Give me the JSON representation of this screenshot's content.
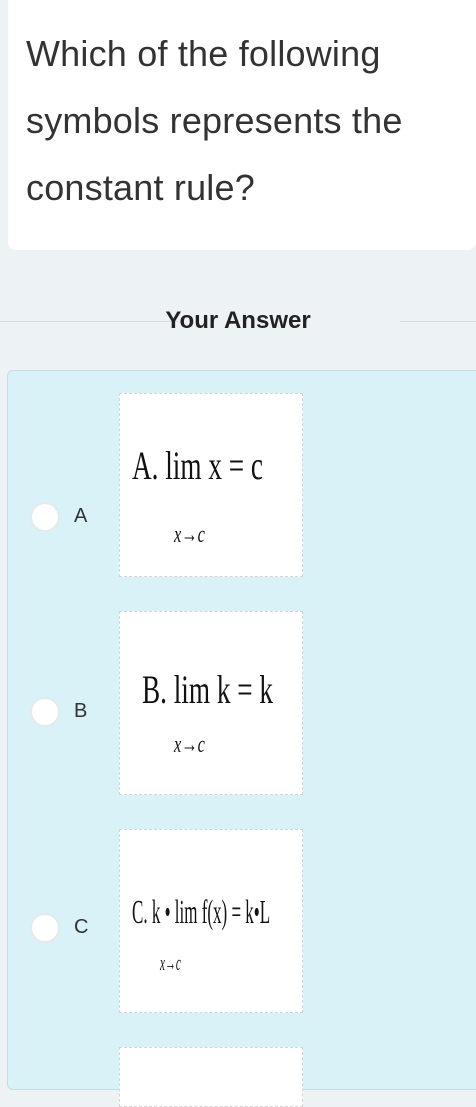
{
  "question": {
    "lines": [
      "Which of the following",
      "symbols represents the",
      "constant rule?"
    ]
  },
  "answer_section": {
    "heading": "Your Answer"
  },
  "options": [
    {
      "letter": "A",
      "formula": "A. lim x = c",
      "subscript": "x→c",
      "selected": false
    },
    {
      "letter": "B",
      "formula": "B. lim k = k",
      "subscript": "x→c",
      "selected": false
    },
    {
      "letter": "C",
      "formula": "C. k • lim f(x) = k•L",
      "subscript": "x→c",
      "selected": false
    }
  ]
}
